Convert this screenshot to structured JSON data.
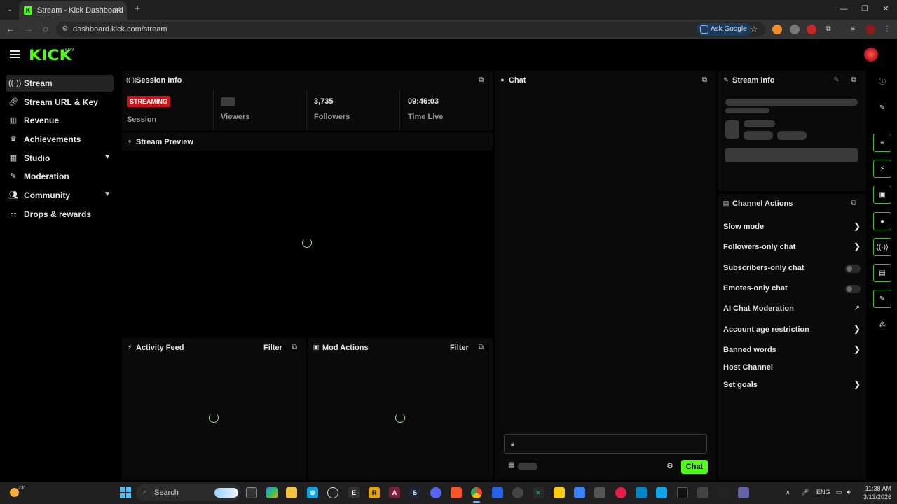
{
  "browser": {
    "tab_title": "Stream - Kick Dashboard",
    "url": "dashboard.kick.com/stream",
    "ask_google": "Ask Google"
  },
  "app": {
    "logo": "KICK",
    "beta": "BETA"
  },
  "sidebar": {
    "items": [
      {
        "label": "Stream",
        "icon": "stream-icon",
        "active": true
      },
      {
        "label": "Stream URL & Key",
        "icon": "link-icon"
      },
      {
        "label": "Revenue",
        "icon": "chart-icon"
      },
      {
        "label": "Achievements",
        "icon": "trophy-icon"
      },
      {
        "label": "Studio",
        "icon": "grid-icon",
        "expandable": true
      },
      {
        "label": "Moderation",
        "icon": "wrench-icon"
      },
      {
        "label": "Community",
        "icon": "people-icon",
        "expandable": true
      },
      {
        "label": "Drops & rewards",
        "icon": "gift-icon"
      }
    ]
  },
  "session_info": {
    "title": "Session Info",
    "status_badge": "STREAMING",
    "session_label": "Session",
    "viewers_label": "Viewers",
    "followers_value": "3,735",
    "followers_label": "Followers",
    "time_live_value": "09:46:03",
    "time_live_label": "Time Live"
  },
  "stream_preview": {
    "title": "Stream Preview"
  },
  "activity_feed": {
    "title": "Activity Feed",
    "filter": "Filter"
  },
  "mod_actions": {
    "title": "Mod Actions",
    "filter": "Filter"
  },
  "chat": {
    "title": "Chat",
    "send_label": "Chat"
  },
  "stream_info": {
    "title": "Stream info"
  },
  "channel_actions": {
    "title": "Channel Actions",
    "items": [
      {
        "label": "Slow mode",
        "control": "chevron"
      },
      {
        "label": "Followers-only chat",
        "control": "chevron"
      },
      {
        "label": "Subscribers-only chat",
        "control": "toggle",
        "enabled": false
      },
      {
        "label": "Emotes-only chat",
        "control": "toggle",
        "enabled": false
      },
      {
        "label": "AI Chat Moderation",
        "control": "external-link"
      },
      {
        "label": "Account age restriction",
        "control": "chevron"
      },
      {
        "label": "Banned words",
        "control": "chevron"
      },
      {
        "label": "Host Channel",
        "control": "none"
      },
      {
        "label": "Set goals",
        "control": "chevron"
      }
    ]
  },
  "taskbar": {
    "weather_temp": "23°",
    "search_label": "Search",
    "tray_lang": "ENG",
    "time": "11:38 AM",
    "date": "3/13/2026"
  },
  "colors": {
    "accent_green": "#53fc18",
    "streaming_red": "#c4161c",
    "panel_bg": "#0a0a0a"
  }
}
